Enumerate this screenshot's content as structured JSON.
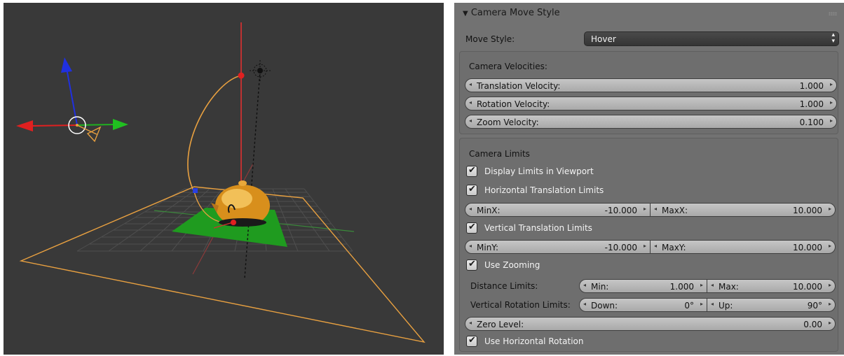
{
  "panel": {
    "title": "Camera Move Style",
    "expanded_glyph": "▼",
    "move_style": {
      "label": "Move Style:",
      "value": "Hover"
    },
    "velocities": {
      "header": "Camera Velocities:",
      "translation": {
        "label": "Translation Velocity:",
        "value": "1.000"
      },
      "rotation": {
        "label": "Rotation Velocity:",
        "value": "1.000"
      },
      "zoom": {
        "label": "Zoom Velocity:",
        "value": "0.100"
      }
    },
    "limits": {
      "header": "Camera Limits",
      "display_limits": {
        "label": "Display Limits in Viewport",
        "checked": true
      },
      "horizontal_limits": {
        "label": "Horizontal Translation Limits",
        "checked": true
      },
      "min_x": {
        "label": "MinX:",
        "value": "-10.000"
      },
      "max_x": {
        "label": "MaxX:",
        "value": "10.000"
      },
      "vertical_limits": {
        "label": "Vertical Translation Limits",
        "checked": true
      },
      "min_y": {
        "label": "MinY:",
        "value": "-10.000"
      },
      "max_y": {
        "label": "MaxY:",
        "value": "10.000"
      },
      "use_zooming": {
        "label": "Use Zooming",
        "checked": true
      },
      "distance_limits": {
        "label": "Distance Limits:",
        "min": {
          "label": "Min:",
          "value": "1.000"
        },
        "max": {
          "label": "Max:",
          "value": "10.000"
        }
      },
      "vertical_rotation_limits": {
        "label": "Vertical Rotation Limits:",
        "down": {
          "label": "Down:",
          "value": "0°"
        },
        "up": {
          "label": "Up:",
          "value": "90°"
        }
      },
      "zero_level": {
        "label": "Zero Level:",
        "value": "0.00"
      },
      "horizontal_rotation": {
        "label": "Use Horizontal Rotation",
        "checked": true
      }
    }
  },
  "glyphs": {
    "check": "✔",
    "left_arrow": "◂",
    "right_arrow": "▸",
    "updown": "▲▼"
  },
  "colors": {
    "viewport_bg": "#393939",
    "panel_bg": "#727272",
    "selection_orange": "#f0a030",
    "x_axis": "#e02020",
    "y_axis": "#20c020",
    "z_axis": "#2030e0"
  }
}
